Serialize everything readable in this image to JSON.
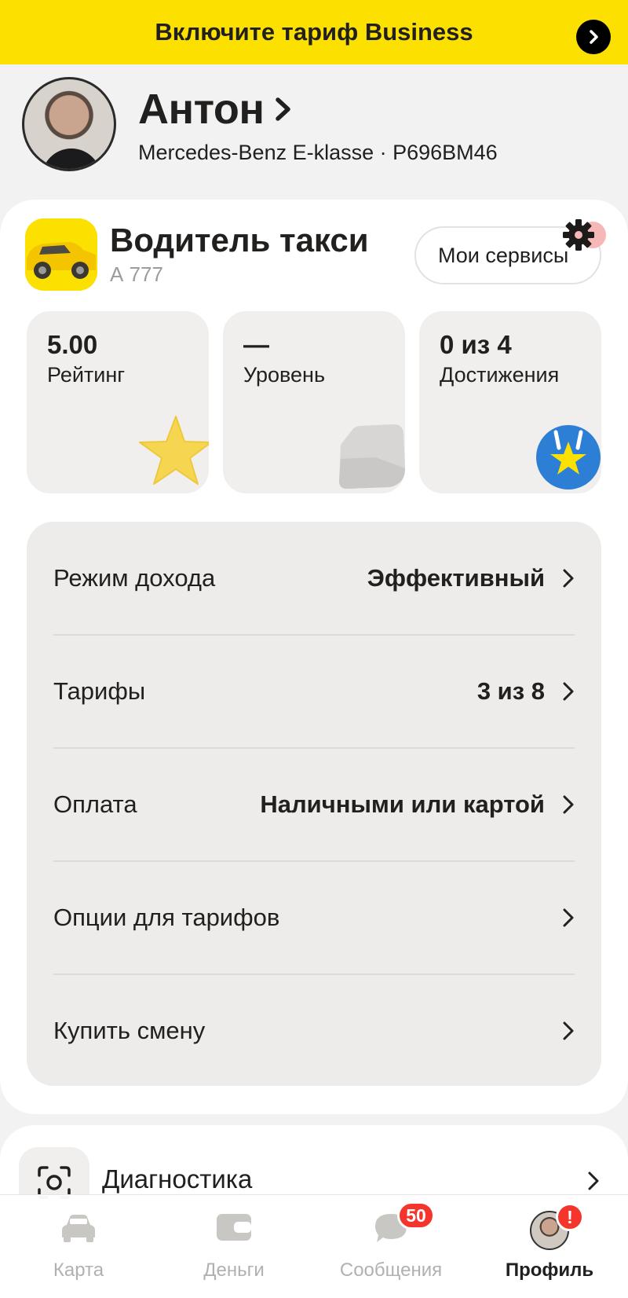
{
  "banner": {
    "text": "Включите тариф Business"
  },
  "profile": {
    "name": "Антон",
    "car": "Mercedes-Benz E-klasse · Р696ВМ46"
  },
  "service": {
    "title": "Водитель такси",
    "subtitle": "А 777",
    "my_services_label": "Мои сервисы"
  },
  "stats": [
    {
      "value": "5.00",
      "label": "Рейтинг",
      "icon": "star-icon"
    },
    {
      "value": "—",
      "label": "Уровень",
      "icon": "level-badge-icon"
    },
    {
      "value": "0 из 4",
      "label": "Достижения",
      "icon": "achievement-icon"
    }
  ],
  "settings": [
    {
      "label": "Режим дохода",
      "value": "Эффективный"
    },
    {
      "label": "Тарифы",
      "value": "3 из 8"
    },
    {
      "label": "Оплата",
      "value": "Наличными или картой"
    },
    {
      "label": "Опции для тарифов",
      "value": ""
    },
    {
      "label": "Купить смену",
      "value": ""
    }
  ],
  "diagnostics": {
    "label": "Диагностика"
  },
  "tabbar": {
    "tabs": [
      {
        "label": "Карта",
        "icon": "car-icon"
      },
      {
        "label": "Деньги",
        "icon": "wallet-icon"
      },
      {
        "label": "Сообщения",
        "icon": "chat-icon",
        "badge": "50"
      },
      {
        "label": "Профиль",
        "icon": "avatar-icon",
        "badge": "!"
      }
    ]
  },
  "colors": {
    "brand_yellow": "#fce000",
    "badge_red": "#f5352c"
  }
}
